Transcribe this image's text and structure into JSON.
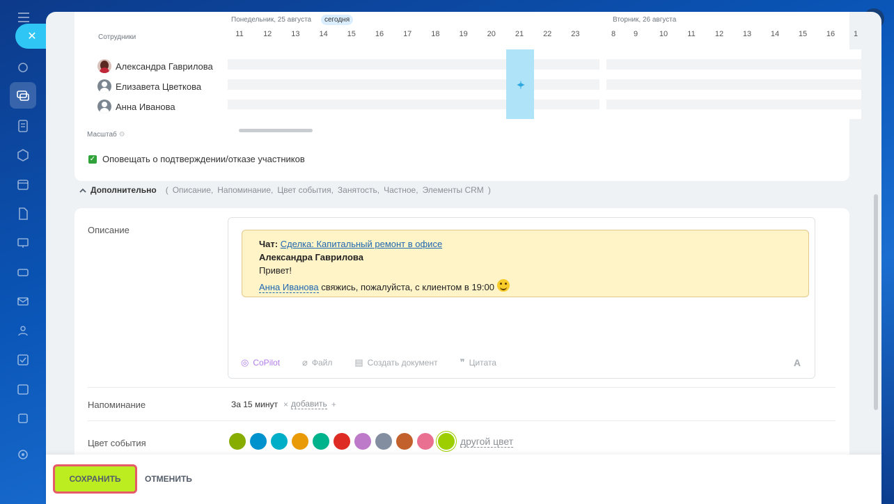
{
  "sidebar": {
    "icons": [
      "menu-icon",
      "close-icon",
      "activity-icon",
      "chat-icon",
      "tasks-icon",
      "hexagon-icon",
      "calendar-icon",
      "document-icon",
      "board-icon",
      "drive-icon",
      "mail-icon",
      "group-icon",
      "check-icon",
      "schedule-icon",
      "storage-icon",
      "settings-icon"
    ]
  },
  "planner": {
    "day1_label": "Понедельник, 25 августа",
    "today_badge": "сегодня",
    "day2_label": "Вторник, 26 августа",
    "hours_day1": [
      "11",
      "12",
      "13",
      "14",
      "15",
      "16",
      "17",
      "18",
      "19",
      "20",
      "21",
      "22",
      "23"
    ],
    "hours_day2": [
      "8",
      "9",
      "10",
      "11",
      "12",
      "13",
      "14",
      "15",
      "16",
      "1"
    ],
    "employees_title": "Сотрудники",
    "employees": [
      {
        "name": "Александра Гаврилова"
      },
      {
        "name": "Елизавета Цветкова"
      },
      {
        "name": "Анна Иванова"
      }
    ],
    "scale_label": "Масштаб"
  },
  "notify": {
    "label": "Оповещать о подтверждении/отказе участников",
    "checked": true
  },
  "additional": {
    "title": "Дополнительно",
    "open_paren": "(",
    "items": [
      "Описание,",
      "Напоминание,",
      "Цвет события,",
      "Занятость,",
      "Частное,",
      "Элементы CRM"
    ],
    "close_paren": ")"
  },
  "description": {
    "label": "Описание",
    "quote": {
      "chat_prefix": "Чат:",
      "chat_link": "Сделка: Капитальный ремонт в офисе",
      "author": "Александра Гаврилова",
      "line1": "Привет!",
      "mention": "Анна Иванова",
      "line2": "свяжись, пожалуйста, с клиентом в 19:00"
    },
    "toolbar": {
      "copilot": "CoPilot",
      "file": "Файл",
      "create_doc": "Создать документ",
      "quote": "Цитата",
      "font": "A"
    }
  },
  "reminder": {
    "label": "Напоминание",
    "value": "За 15 минут",
    "remove": "×",
    "add": "добавить",
    "plus": "+"
  },
  "event_color": {
    "label": "Цвет события",
    "colors": [
      "#86ad00",
      "#0092cc",
      "#00afc7",
      "#e89b06",
      "#00b38c",
      "#de2b24",
      "#bd7ac9",
      "#838fa0",
      "#c3612c",
      "#e97090",
      "#9dcf00"
    ],
    "selected_index": 10,
    "other": "другой цвет"
  },
  "footer": {
    "save": "СОХРАНИТЬ",
    "cancel": "ОТМЕНИТЬ"
  }
}
